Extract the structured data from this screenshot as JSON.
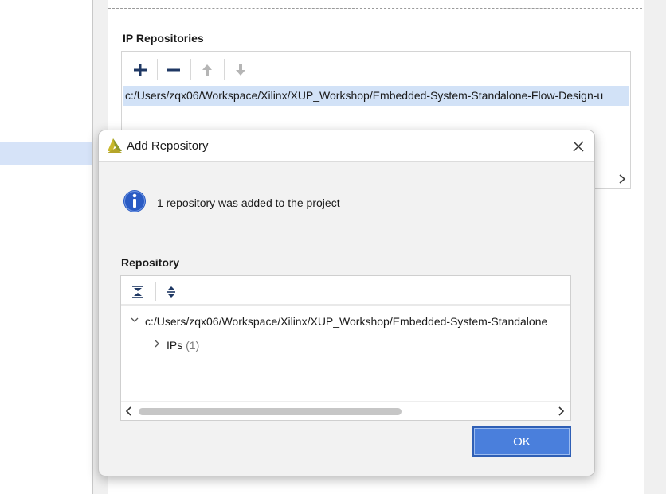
{
  "background_window": {
    "ip_repositories_title": "IP Repositories",
    "toolbar": {
      "add_icon": "plus-icon",
      "remove_icon": "minus-icon",
      "move_up_icon": "arrow-up-icon",
      "move_down_icon": "arrow-down-icon"
    },
    "repository_path": "c:/Users/zqx06/Workspace/Xilinx/XUP_Workshop/Embedded-System-Standalone-Flow-Design-u"
  },
  "dialog": {
    "title": "Add Repository",
    "logo_icon": "vivado-logo-icon",
    "close_icon": "close-icon",
    "info_icon": "info-icon",
    "message": "1 repository was added to the project",
    "repository_section_title": "Repository",
    "toolbar": {
      "collapse_all_icon": "collapse-all-icon",
      "expand_all_icon": "expand-all-icon"
    },
    "tree": {
      "root": {
        "label": "c:/Users/zqx06/Workspace/Xilinx/XUP_Workshop/Embedded-System-Standalone",
        "expanded": true,
        "children": [
          {
            "label": "IPs",
            "count": "(1)",
            "expanded": false
          }
        ]
      }
    },
    "ok_label": "OK"
  },
  "colors": {
    "selection_blue": "#d2e2f7",
    "ok_button": "#4a7fdc",
    "info_icon_blue": "#2a5bc4",
    "toolbar_icon_navy": "#1f3864"
  }
}
